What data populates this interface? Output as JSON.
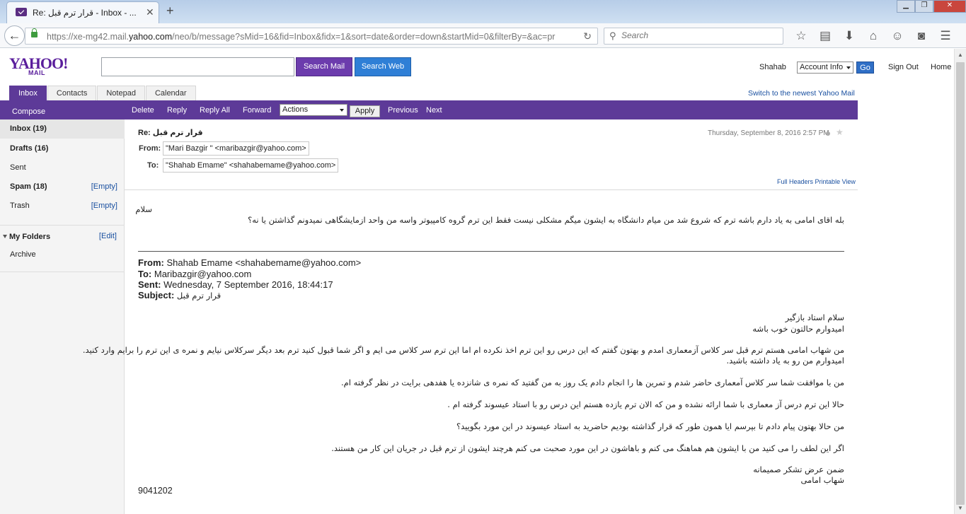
{
  "browser": {
    "tab_title": "Re: قرار ترم قبل - Inbox - ...",
    "tab_close": "✕",
    "newtab": "+",
    "url_prefix": "https://xe-mg42.mail.",
    "url_domain": "yahoo.com",
    "url_suffix": "/neo/b/message?sMid=16&fid=Inbox&fidx=1&sort=date&order=down&startMid=0&filterBy=&ac=pr",
    "search_placeholder": "Search"
  },
  "yahoo": {
    "logo": "YAHOO!",
    "logo_sub": "MAIL",
    "search_mail_label": "Search Mail",
    "search_web_label": "Search Web",
    "user_name": "Shahab",
    "account_info": "Account Info",
    "go_label": "Go",
    "signout_label": "Sign Out",
    "home_label": "Home",
    "switch_link": "Switch to the newest Yahoo Mail"
  },
  "tabs": [
    "Inbox",
    "Contacts",
    "Notepad",
    "Calendar"
  ],
  "toolbar": {
    "compose": "Compose",
    "delete": "Delete",
    "reply": "Reply",
    "reply_all": "Reply All",
    "forward": "Forward",
    "actions": "Actions",
    "apply": "Apply",
    "previous": "Previous",
    "next": "Next"
  },
  "sidebar": {
    "inbox": "Inbox (19)",
    "drafts": "Drafts (16)",
    "sent": "Sent",
    "spam": "Spam (18)",
    "spam_empty": "[Empty]",
    "trash": "Trash",
    "trash_empty": "[Empty]",
    "my_folders": "My Folders",
    "edit": "[Edit]",
    "archive": "Archive"
  },
  "message": {
    "subject": "Re: قرار ترم قبل",
    "date": "Thursday, September 8, 2016 2:57 PM",
    "from_label": "From:",
    "from_value": "\"Mari Bazgir \" <maribazgir@yahoo.com>",
    "to_label": "To:",
    "to_value": "\"Shahab Emame\" <shahabemame@yahoo.com>",
    "full_headers": "Full Headers",
    "printable_view": "Printable View",
    "greeting": "سلام",
    "reply_line": "بله اقای امامی به یاد دارم باشه ترم که شروع شد من میام دانشگاه به ایشون میگم مشکلی نیست فقط این ترم گروه کامپیوتر واسه من واحد ازمایشگاهی نمیدونم گذاشتن یا نه؟"
  },
  "quoted": {
    "from_label": "From:",
    "from_value": "Shahab Emame <shahabemame@yahoo.com>",
    "to_label": "To:",
    "to_value": "Maribazgir@yahoo.com",
    "sent_label": "Sent:",
    "sent_value": "Wednesday, 7 September 2016, 18:44:17",
    "subject_label": "Subject:",
    "subject_value": "قرار ترم قبل",
    "lines": [
      "سلام استاد بازگیر",
      "امیدوارم حالتون خوب باشه",
      "من شهاب امامی هستم  ترم قبل سر کلاس آزمعماری امدم و بهتون گفتم که این درس رو این ترم اخذ نکرده ام اما این ترم سر کلاس می ایم و اگر شما قبول کنید ترم بعد دیگر سرکلاس نیایم و نمره ی این ترم را برایم وارد کنید.",
      "امیدوارم من رو به یاد داشته باشید.",
      "من با موافقت شما سر کلاس آمعماری حاضر شدم و تمرین ها را انجام دادم  یک روز به من گفتید که نمره ی شانزده یا هفدهی برایت در نظر گرفته ام.",
      "حالا این ترم درس آز معماری با شما ارائه نشده و من که الان ترم یازده هستم این درس رو با استاد عیسوند گرفته ام .",
      "من حالا بهتون پیام دادم تا بپرسم ایا همون طور که قرار گذاشته بودیم حاضرید به استاد عیسوند در این مورد بگویید؟",
      "اگر این لطف را می کنید من با ایشون هم هماهنگ می کنم و باهاشون در این مورد صحبت می کنم هرچند ایشون از ترم قبل در جریان این کار من هستند.",
      "ضمن عرض تشکر صمیمانه",
      "شهاب امامی"
    ],
    "student_number": "9041202"
  }
}
